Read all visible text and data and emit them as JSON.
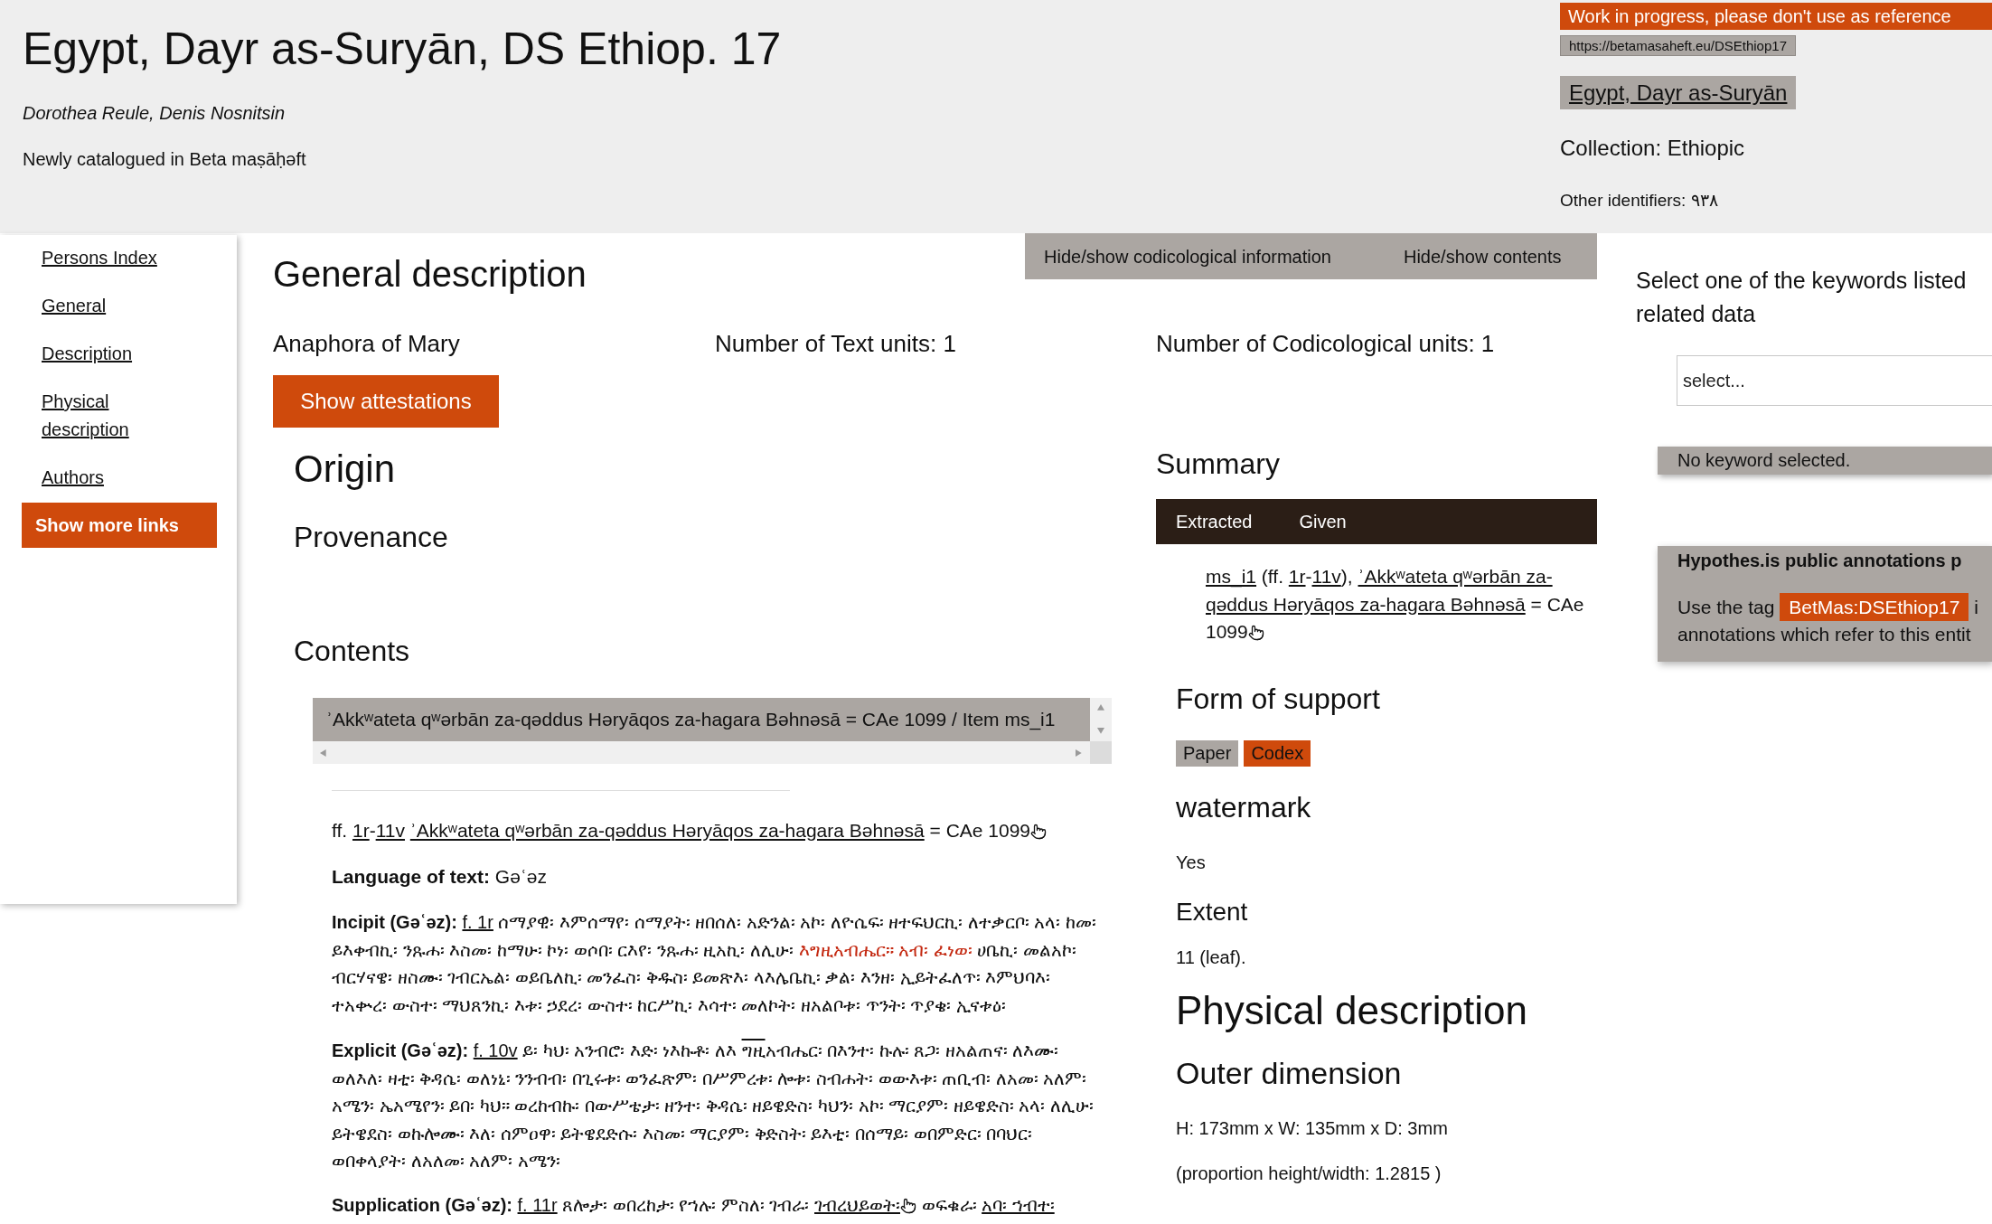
{
  "header": {
    "title": "Egypt, Dayr as-Suryān, DS Ethiop. 17",
    "authors": "Dorothea Reule, Denis Nosnitsin",
    "note": "Newly catalogued in Beta maṣāḥǝft",
    "banner": "Work in progress, please don't use as reference",
    "url": "https://betamasaheft.eu/DSEthiop17",
    "repository": "Egypt, Dayr as-Suryān",
    "collection": "Collection: Ethiopic",
    "other_identifiers": "Other identifiers: ٩٣٨"
  },
  "sidebar": {
    "links": [
      "Persons Index",
      "General",
      "Description",
      "Physical description",
      "Authors"
    ],
    "more_button": "Show more links"
  },
  "toolbar": {
    "buttons": [
      "Hide/show codicological information",
      "Hide/show contents"
    ]
  },
  "general_description": {
    "heading": "General description",
    "work_title": "Anaphora of Mary",
    "text_units": "Number of Text units: 1",
    "codicological_units": "Number of Codicological units: 1",
    "attestations_button": "Show attestations"
  },
  "origin": {
    "heading": "Origin",
    "provenance_heading": "Provenance"
  },
  "contents": {
    "heading": "Contents",
    "item_tab": "ʾAkkʷateta qʷǝrbān za-qǝddus Hǝryāqos za-hagara Bǝhnǝsā = CAe 1099 / Item ms_i1",
    "folio_line": [
      {
        "kind": "text",
        "text": "ff. "
      },
      {
        "kind": "link",
        "text": "1r"
      },
      {
        "kind": "text",
        "text": "-"
      },
      {
        "kind": "link",
        "text": "11v"
      },
      {
        "kind": "link",
        "text": "ʾAkkʷateta qʷǝrbān za-qǝddus Hǝryāqos za-hagara Bǝhnǝsā",
        "space_before": true
      },
      {
        "kind": "text",
        "text": " = CAe 1099"
      },
      {
        "kind": "hand"
      }
    ],
    "language": {
      "label": "Language of text:",
      "value": "Gǝʿǝz"
    },
    "incipit": {
      "label": "Incipit (Gǝʿǝz):",
      "segments": [
        {
          "kind": "link",
          "text": "f. 1r"
        },
        {
          "kind": "text",
          "text": " ሰማያዊ፡ እምሰማየ፡ ሰማያት፡ ዘበሰለ፡ አድንል፡ አኮ፡ ለዮሴፍ፡ ዘተፍህርኪ፡ ለተቃርቦ፡ አላ፡ ከመ፡ ይእቀብኪ፡ ንጹሐ፡ እስመ፡ ከማሁ፡ ኮነ፡ ወሶበ፡ ርእየ፡ ንጹሐ፡ ዚአኪ፡ ለሊሁ፡ "
        },
        {
          "kind": "rubric",
          "text": "እግዚአብሔር። አብ፡ ፈነወ፡"
        },
        {
          "kind": "text",
          "text": " ሀቤኪ፡ መልአኮ፡ ብርሃናዌ፡ ዘስሙ፡ ገብርኤል፡ ወይቤለኪ፡ መንፈስ፡ ቅዱስ፡ ይመጽእ፡ ላእሌቤኪ፡ ቃል፡ እንዘ፡ ኢይትፈለጥ፡ እምህባእ፡ ተአቍረ፡ ውስተ፡ ማህጸንኪ፡ እቱ፡ ኃደረ፡ ውስተ፡ ከርሥኪ፡ እሳተ፡ መለኮት፡ ዘአልቦቱ፡ ጥንት፡ ጥያቄ፡ ኢናቱዕ፡"
        }
      ]
    },
    "explicit": {
      "label": "Explicit (Gǝʿǝz):",
      "segments": [
        {
          "kind": "link",
          "text": "f. 10v"
        },
        {
          "kind": "text",
          "text": " ይ፡ ካህ፡ አንብሮ፡ እድ፡ ነእኩቶ፡ ለእ "
        },
        {
          "kind": "abbreviation",
          "text": "ግዚ"
        },
        {
          "kind": "text",
          "text": "አብሔር፡ በእንተ፡ ኩሉ፡ ጸጋ፡ ዘአልጠና፡ ለእሙ፡ ወለእለ፡ ዛቲ፡ ቅዳሴ፡ ወለነኒ፡ ንንብብ፡ በጊሩቱ፡ ወንፈጽም፡ በሥምረቱ፡ ሎቱ፡ ስብሐት፡ ወውእቱ፡ ጠቢብ፡ ለአመ፡ አለም፡ አሜን፡ ኤአሜየን፡ ይበ፡ ካህ። ወረከብኩ፡ በውሥቴታ፡ ዘንተ፡ ቅዳሴ፡ ዘይዌድስ፡ ካህን፡ አኮ፡ ማርያም፡ ዘይዌድስ፡ አላ፡ ለሊሁ፡ ይትዌደስ፡ ወኩሎሙ፡ እለ፡ ሰምዐዋ፡ ይትዌደድሱ፡ እስመ፡ ማርያም፡ ቅድስት፡ ይእቲ፡ በሰማይ፡ ወበምድር፡ በባህር፡ ወበቀላያት፡ ለአለመ፡ አለም፡ አሜን፡"
        }
      ]
    },
    "supplication": {
      "label": "Supplication (Gǝʿǝz):",
      "segments": [
        {
          "kind": "link",
          "text": "f. 11r"
        },
        {
          "kind": "text",
          "text": " ጸሎታ፡ ወበረከታ፡ የኀሉ፡ ምስለ፡ ገብራ፡ "
        },
        {
          "kind": "link",
          "text": "ገብረህይወት፡"
        },
        {
          "kind": "hand"
        },
        {
          "kind": "text",
          "text": " ወፍቁራ፡ "
        },
        {
          "kind": "link",
          "text": "አባ፡ ኀብተ፡"
        }
      ]
    }
  },
  "summary": {
    "heading": "Summary",
    "tabs": [
      {
        "label": "Extracted"
      },
      {
        "label": "Given"
      }
    ],
    "entry": [
      {
        "kind": "link",
        "text": "ms_i1"
      },
      {
        "kind": "text",
        "text": " (ff. "
      },
      {
        "kind": "link",
        "text": "1r"
      },
      {
        "kind": "text",
        "text": "-"
      },
      {
        "kind": "link",
        "text": "11v"
      },
      {
        "kind": "text",
        "text": "), "
      },
      {
        "kind": "link",
        "text": "ʾAkkʷateta qʷǝrbān za-"
      },
      {
        "kind": "link",
        "text": "qǝddus Hǝryāqos za-hagara Bǝhnǝsā"
      },
      {
        "kind": "text",
        "text": " = CAe 1099"
      },
      {
        "kind": "hand"
      }
    ]
  },
  "form_of_support": {
    "heading": "Form of support",
    "tags": [
      {
        "label": "Paper",
        "color": "#aba6a2"
      },
      {
        "label": "Codex",
        "color": "#cf4a0c"
      }
    ]
  },
  "watermark": {
    "heading": "watermark",
    "value": "Yes"
  },
  "extent": {
    "heading": "Extent",
    "value": "11 (leaf)."
  },
  "physical_description": {
    "heading": "Physical description",
    "outer_dimension": {
      "heading": "Outer dimension",
      "dimensions": "H: 173mm x W: 135mm x D: 3mm",
      "proportion": "(proportion height/width: 1.2815 )"
    }
  },
  "keywords": {
    "prompt_lines": [
      "Select one of the keywords listed",
      "related data"
    ],
    "select": {
      "placeholder": "select..."
    },
    "status": "No keyword selected."
  },
  "annotations": {
    "title": "Hypothes.is public annotations p",
    "lines": [
      [
        {
          "kind": "text",
          "text": "Use the tag "
        },
        {
          "kind": "tag",
          "text": "BetMas:DSEthiop17"
        },
        {
          "kind": "text",
          "text": " i"
        }
      ],
      [
        {
          "kind": "text",
          "text": "annotations which refer to this entit"
        }
      ]
    ]
  }
}
